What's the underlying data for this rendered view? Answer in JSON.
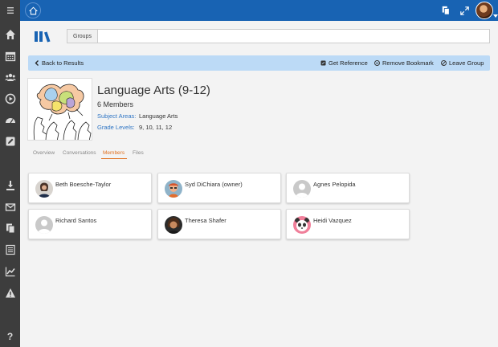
{
  "sidebar": {
    "items": [
      {
        "icon": "menu-icon"
      },
      {
        "icon": "home-icon"
      },
      {
        "icon": "calendar-icon"
      },
      {
        "icon": "users-icon"
      },
      {
        "icon": "play-circle-icon"
      },
      {
        "icon": "dashboard-icon"
      },
      {
        "icon": "edit-icon"
      },
      {
        "icon": "download-icon"
      },
      {
        "icon": "mail-icon"
      },
      {
        "icon": "copy-icon"
      },
      {
        "icon": "list-icon"
      },
      {
        "icon": "chart-icon"
      },
      {
        "icon": "warning-icon"
      },
      {
        "icon": "help-icon"
      }
    ],
    "help_label": "?"
  },
  "topbar": {
    "icons": [
      "home-icon",
      "copy-icon",
      "expand-icon",
      "user-avatar"
    ],
    "color": "#1863b3"
  },
  "search": {
    "label": "Groups",
    "value": "",
    "placeholder": ""
  },
  "actionbar": {
    "back_label": "Back to Results",
    "get_reference_label": "Get Reference",
    "remove_bookmark_label": "Remove Bookmark",
    "leave_group_label": "Leave Group"
  },
  "group": {
    "title": "Language Arts (9-12)",
    "members_count": "6 Members",
    "subject_areas_label": "Subject Areas:",
    "subject_areas_value": "Language Arts",
    "grade_levels_label": "Grade Levels:",
    "grade_levels_value": "9, 10, 11, 12"
  },
  "tabs": [
    {
      "label": "Overview",
      "active": false
    },
    {
      "label": "Conversations",
      "active": false
    },
    {
      "label": "Members",
      "active": true
    },
    {
      "label": "Files",
      "active": false
    }
  ],
  "members": [
    {
      "name": "Beth Boesche-Taylor",
      "avatar": "photo"
    },
    {
      "name": "Syd DiChiara (owner)",
      "avatar": "cartoon"
    },
    {
      "name": "Agnes Pelopida",
      "avatar": "placeholder"
    },
    {
      "name": "Richard Santos",
      "avatar": "placeholder"
    },
    {
      "name": "Theresa Shafer",
      "avatar": "photo"
    },
    {
      "name": "Heidi Vazquez",
      "avatar": "panda"
    }
  ],
  "colors": {
    "accent": "#1863b3",
    "action_bar": "#bcdaf6",
    "active_tab": "#e0701f",
    "link": "#2f75c4"
  }
}
